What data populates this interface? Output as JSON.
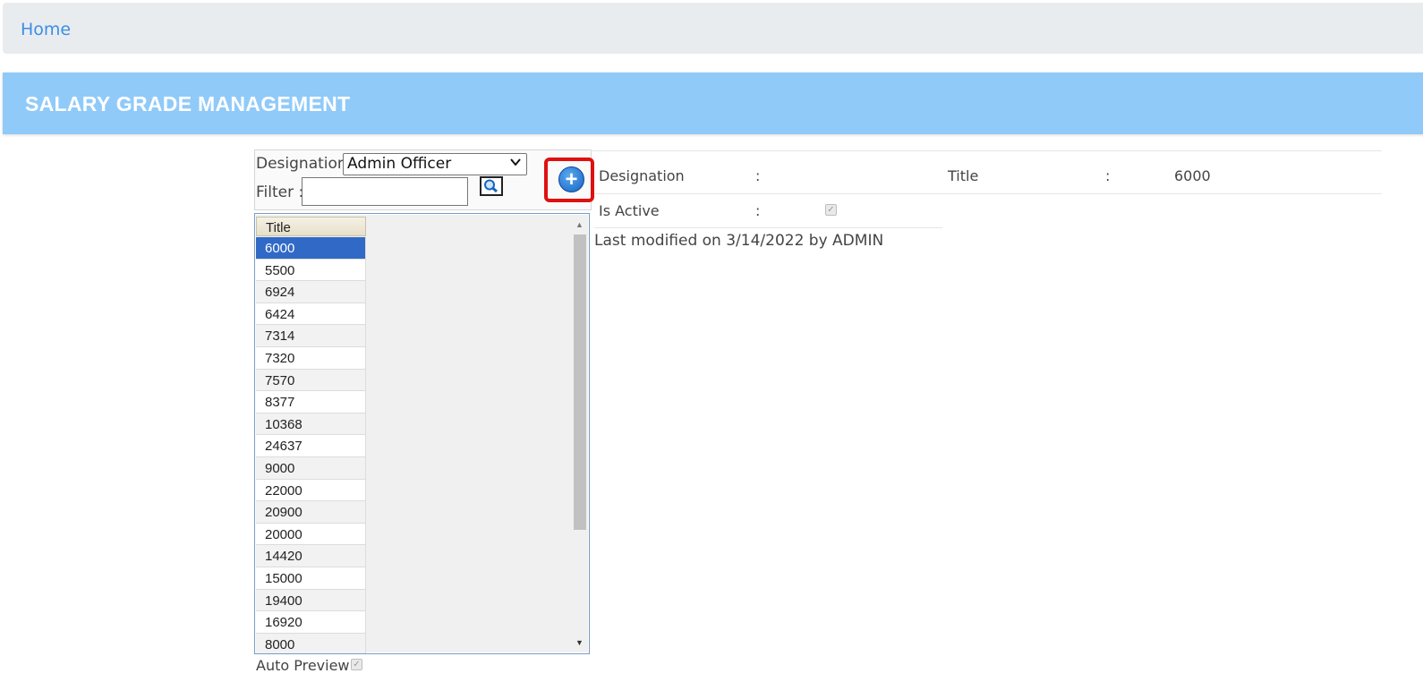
{
  "breadcrumb": {
    "home": "Home"
  },
  "page": {
    "title": "SALARY GRADE MANAGEMENT"
  },
  "toolbar": {
    "designation_label": "Designation",
    "designation_value": "Admin Officer",
    "filter_label": "Filter :",
    "filter_value": ""
  },
  "grid": {
    "column_header": "Title",
    "rows": [
      "6000",
      "5500",
      "6924",
      "6424",
      "7314",
      "7320",
      "7570",
      "8377",
      "10368",
      "24637",
      "9000",
      "22000",
      "20900",
      "20000",
      "14420",
      "15000",
      "19400",
      "16920",
      "8000"
    ],
    "selected_index": 0
  },
  "auto_preview": {
    "label": "Auto Preview",
    "checked": true
  },
  "detail": {
    "designation_label": "Designation",
    "designation_sep": ":",
    "designation_value": "",
    "title_label": "Title",
    "title_sep": ":",
    "title_value": "6000",
    "is_active_label": "Is Active",
    "is_active_sep": ":",
    "is_active_checked": true,
    "last_modified": "Last modified on 3/14/2022 by ADMIN"
  },
  "colors": {
    "header_bg": "#90caf9",
    "selected_row": "#3169c6",
    "highlight": "#e01010"
  }
}
